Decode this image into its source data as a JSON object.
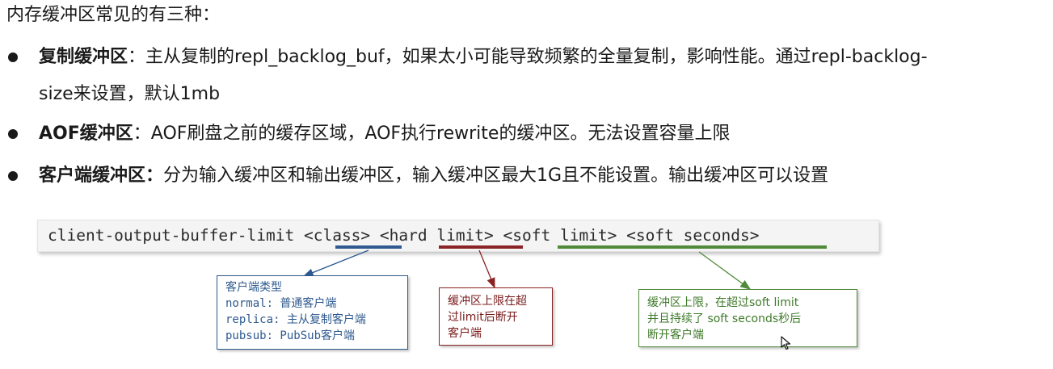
{
  "intro": "内存缓冲区常见的有三种：",
  "bullets": [
    {
      "title": "复制缓冲区",
      "sep": "：",
      "line1": "主从复制的repl_backlog_buf，如果太小可能导致频繁的全量复制，影响性能。通过repl-backlog-",
      "line2": "size来设置，默认1mb"
    },
    {
      "title": "AOF缓冲区",
      "sep": "：",
      "line1": "AOF刷盘之前的缓存区域，AOF执行rewrite的缓冲区。无法设置容量上限"
    },
    {
      "title": "客户端缓冲区：",
      "sep": "",
      "line1": "分为输入缓冲区和输出缓冲区，输入缓冲区最大1G且不能设置。输出缓冲区可以设置"
    }
  ],
  "code": "client-output-buffer-limit <class> <hard limit> <soft limit> <soft seconds>",
  "annotations": {
    "class": {
      "lines": [
        "客户端类型",
        "normal: 普通客户端",
        "replica: 主从复制客户端",
        "pubsub: PubSub客户端"
      ]
    },
    "hard": {
      "lines": [
        "缓冲区上限在超",
        "过limit后断开",
        "客户端"
      ]
    },
    "soft": {
      "lines": [
        "缓冲区上限，在超过soft limit",
        "并且持续了 soft seconds秒后",
        "断开客户端"
      ]
    }
  },
  "colors": {
    "blue": "#2e5a8f",
    "red": "#8a2323",
    "green": "#4f8a3a"
  },
  "icons": {
    "bullet": "bullet-dot",
    "cursor": "mouse-pointer"
  }
}
